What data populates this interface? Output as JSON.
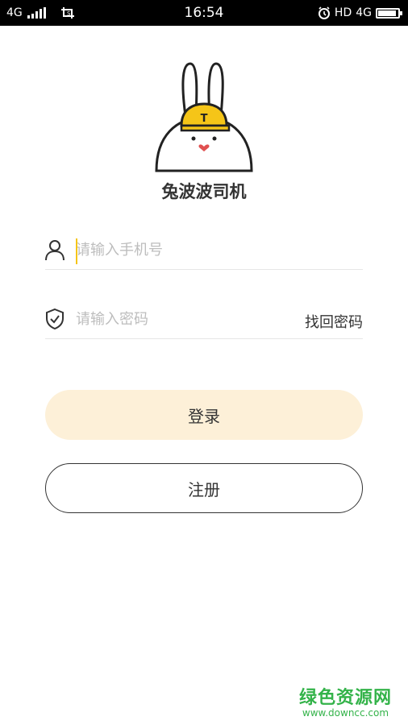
{
  "status_bar": {
    "network_left": "4G",
    "time": "16:54",
    "hd_label": "HD",
    "network_right": "4G",
    "icons": [
      "signal-icon",
      "screenshot-icon",
      "alarm-icon",
      "battery-icon"
    ]
  },
  "app": {
    "name": "兔波波司机",
    "logo_letter": "T"
  },
  "form": {
    "phone_placeholder": "请输入手机号",
    "phone_value": "",
    "password_placeholder": "请输入密码",
    "password_value": "",
    "recover_password_label": "找回密码"
  },
  "buttons": {
    "login_label": "登录",
    "register_label": "注册"
  },
  "watermark": {
    "main": "绿色资源网",
    "sub": "www.downcc.com"
  },
  "colors": {
    "accent_yellow": "#f5c518",
    "login_bg": "#fdf0d8",
    "watermark_green": "#34b34a"
  }
}
